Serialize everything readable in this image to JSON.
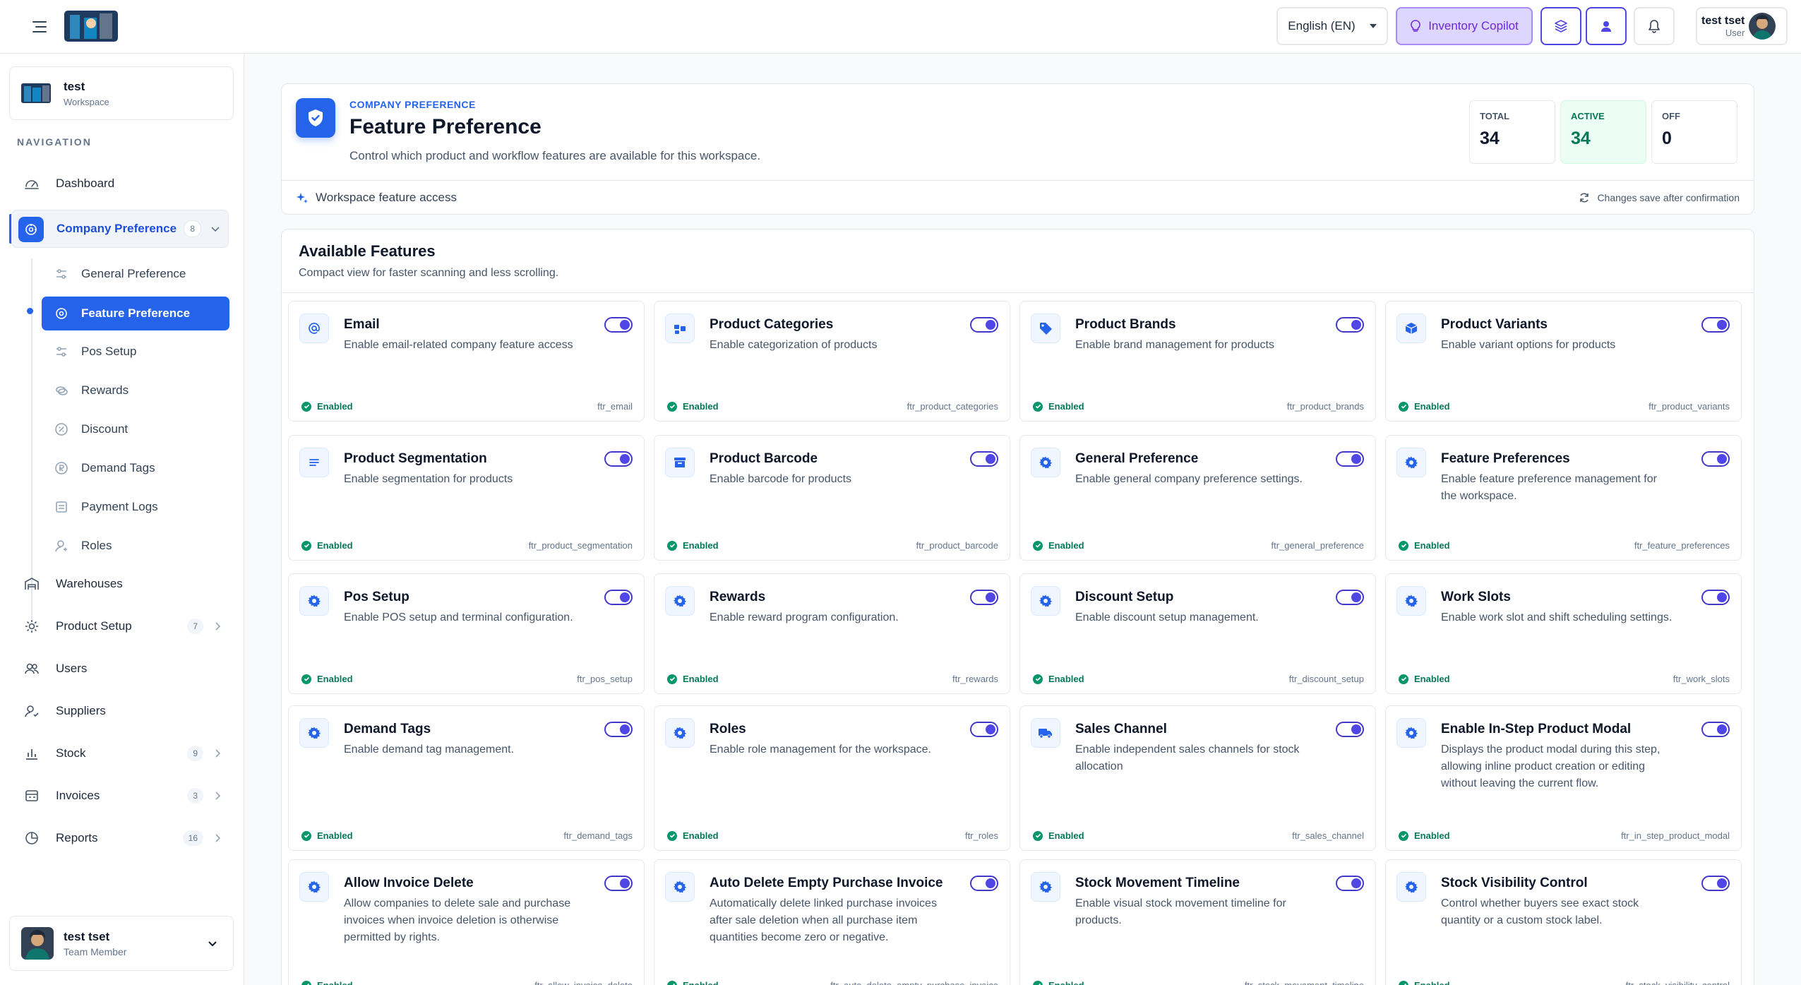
{
  "header": {
    "language": "English (EN)",
    "copilot_label": "Inventory Copilot",
    "user_name": "test tset",
    "user_role": "User"
  },
  "sidebar": {
    "workspace_name": "test",
    "workspace_label": "Workspace",
    "nav_heading": "NAVIGATION",
    "items": [
      {
        "label": "Dashboard",
        "icon": "dashboard-icon"
      },
      {
        "label": "Company Preference",
        "badge": "8",
        "icon": "company-icon"
      },
      {
        "label": "Warehouses",
        "icon": "warehouse-icon"
      },
      {
        "label": "Product Setup",
        "badge": "7",
        "icon": "gear-icon"
      },
      {
        "label": "Users",
        "icon": "users-icon"
      },
      {
        "label": "Suppliers",
        "icon": "supplier-icon"
      },
      {
        "label": "Stock",
        "badge": "9",
        "icon": "chart-icon"
      },
      {
        "label": "Invoices",
        "badge": "3",
        "icon": "invoice-icon"
      },
      {
        "label": "Reports",
        "badge": "16",
        "icon": "reports-icon"
      }
    ],
    "sub_items": [
      {
        "label": "General Preference"
      },
      {
        "label": "Feature Preference"
      },
      {
        "label": "Pos Setup"
      },
      {
        "label": "Rewards"
      },
      {
        "label": "Discount"
      },
      {
        "label": "Demand Tags"
      },
      {
        "label": "Payment Logs"
      },
      {
        "label": "Roles"
      }
    ],
    "footer_user_name": "test tset",
    "footer_user_role": "Team Member"
  },
  "hero": {
    "eyebrow": "COMPANY PREFERENCE",
    "title": "Feature Preference",
    "description": "Control which product and workflow features are available for this workspace.",
    "stats": [
      {
        "label": "TOTAL",
        "value": "34"
      },
      {
        "label": "ACTIVE",
        "value": "34"
      },
      {
        "label": "OFF",
        "value": "0"
      }
    ],
    "access_label": "Workspace feature access",
    "save_note": "Changes save after confirmation"
  },
  "features": {
    "title": "Available Features",
    "subtitle": "Compact view for faster scanning and less scrolling.",
    "status_label": "Enabled",
    "cards": [
      {
        "title": "Email",
        "desc": "Enable email-related company feature access",
        "key": "ftr_email",
        "icon": "at-icon"
      },
      {
        "title": "Product Categories",
        "desc": "Enable categorization of products",
        "key": "ftr_product_categories",
        "icon": "category-icon"
      },
      {
        "title": "Product Brands",
        "desc": "Enable brand management for products",
        "key": "ftr_product_brands",
        "icon": "tag-icon"
      },
      {
        "title": "Product Variants",
        "desc": "Enable variant options for products",
        "key": "ftr_product_variants",
        "icon": "cube-icon"
      },
      {
        "title": "Product Segmentation",
        "desc": "Enable segmentation for products",
        "key": "ftr_product_segmentation",
        "icon": "list-icon"
      },
      {
        "title": "Product Barcode",
        "desc": "Enable barcode for products",
        "key": "ftr_product_barcode",
        "icon": "archive-icon"
      },
      {
        "title": "General Preference",
        "desc": "Enable general company preference settings.",
        "key": "ftr_general_preference",
        "icon": "gear-icon"
      },
      {
        "title": "Feature Preferences",
        "desc": "Enable feature preference management for the workspace.",
        "key": "ftr_feature_preferences",
        "icon": "gear-icon"
      },
      {
        "title": "Pos Setup",
        "desc": "Enable POS setup and terminal configuration.",
        "key": "ftr_pos_setup",
        "icon": "gear-icon"
      },
      {
        "title": "Rewards",
        "desc": "Enable reward program configuration.",
        "key": "ftr_rewards",
        "icon": "gear-icon"
      },
      {
        "title": "Discount Setup",
        "desc": "Enable discount setup management.",
        "key": "ftr_discount_setup",
        "icon": "gear-icon"
      },
      {
        "title": "Work Slots",
        "desc": "Enable work slot and shift scheduling settings.",
        "key": "ftr_work_slots",
        "icon": "gear-icon"
      },
      {
        "title": "Demand Tags",
        "desc": "Enable demand tag management.",
        "key": "ftr_demand_tags",
        "icon": "gear-icon"
      },
      {
        "title": "Roles",
        "desc": "Enable role management for the workspace.",
        "key": "ftr_roles",
        "icon": "gear-icon"
      },
      {
        "title": "Sales Channel",
        "desc": "Enable independent sales channels for stock allocation",
        "key": "ftr_sales_channel",
        "icon": "truck-icon"
      },
      {
        "title": "Enable In-Step Product Modal",
        "desc": "Displays the product modal during this step, allowing inline product creation or editing without leaving the current flow.",
        "key": "ftr_in_step_product_modal",
        "icon": "gear-icon"
      },
      {
        "title": "Allow Invoice Delete",
        "desc": "Allow companies to delete sale and purchase invoices when invoice deletion is otherwise permitted by rights.",
        "key": "ftr_allow_invoice_delete",
        "icon": "gear-icon"
      },
      {
        "title": "Auto Delete Empty Purchase Invoice",
        "desc": "Automatically delete linked purchase invoices after sale deletion when all purchase item quantities become zero or negative.",
        "key": "ftr_auto_delete_empty_purchase_invoice",
        "icon": "gear-icon"
      },
      {
        "title": "Stock Movement Timeline",
        "desc": "Enable visual stock movement timeline for products.",
        "key": "ftr_stock_movement_timeline",
        "icon": "gear-icon"
      },
      {
        "title": "Stock Visibility Control",
        "desc": "Control whether buyers see exact stock quantity or a custom stock label.",
        "key": "ftr_stock_visibility_control",
        "icon": "gear-icon"
      }
    ]
  },
  "colors": {
    "primary": "#2563eb",
    "toggle": "#4f46e5",
    "enabled": "#059669",
    "copilot_bg": "#ddd6fe"
  }
}
